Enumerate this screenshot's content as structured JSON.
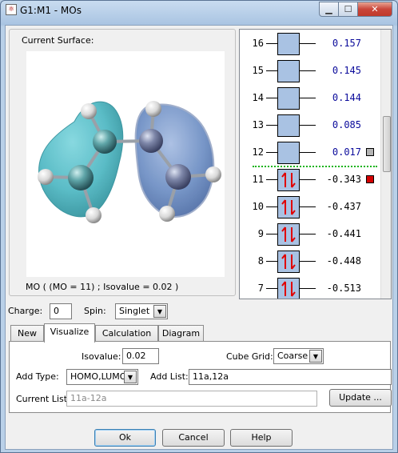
{
  "window": {
    "title": "G1:M1 - MOs",
    "icon": "gaussview-icon",
    "controls": {
      "minimize": "▁",
      "maximize": "☐",
      "close": "✕"
    }
  },
  "surface": {
    "label": "Current Surface:",
    "caption": "MO ( (MO = 11) ; Isovalue = 0.02 )"
  },
  "levels": [
    {
      "num": "16",
      "energy": "0.157",
      "occupied": false,
      "marker": ""
    },
    {
      "num": "15",
      "energy": "0.145",
      "occupied": false,
      "marker": ""
    },
    {
      "num": "14",
      "energy": "0.144",
      "occupied": false,
      "marker": ""
    },
    {
      "num": "13",
      "energy": "0.085",
      "occupied": false,
      "marker": ""
    },
    {
      "num": "12",
      "energy": "0.017",
      "occupied": false,
      "marker": "gray"
    },
    {
      "num": "11",
      "energy": "-0.343",
      "occupied": true,
      "marker": "red"
    },
    {
      "num": "10",
      "energy": "-0.437",
      "occupied": true,
      "marker": ""
    },
    {
      "num": "9",
      "energy": "-0.441",
      "occupied": true,
      "marker": ""
    },
    {
      "num": "8",
      "energy": "-0.448",
      "occupied": true,
      "marker": ""
    },
    {
      "num": "7",
      "energy": "-0.513",
      "occupied": true,
      "marker": ""
    }
  ],
  "colors": {
    "orbital_box": "#a9c2e3",
    "spin_arrow": "#e00000",
    "virtual_energy": "#0b0b9b",
    "homo_lumo_separator": "#19b319",
    "marker_gray": "#b4b4b4",
    "marker_red": "#d40000",
    "lobe_cyan": "#4fb8c3",
    "lobe_blue": "#6e8fc4"
  },
  "charge": {
    "label": "Charge:",
    "value": "0"
  },
  "spin": {
    "label": "Spin:",
    "value": "Singlet"
  },
  "tabs": [
    "New",
    "Visualize",
    "Calculation",
    "Diagram"
  ],
  "active_tab": "Visualize",
  "visualize": {
    "isovalue_label": "Isovalue:",
    "isovalue": "0.02",
    "cube_grid_label": "Cube Grid:",
    "cube_grid": "Coarse",
    "add_type_label": "Add Type:",
    "add_type": "HOMO,LUMO",
    "add_list_label": "Add List:",
    "add_list": "11a,12a",
    "current_list_label": "Current List:",
    "current_list": "11a-12a",
    "update_label": "Update ..."
  },
  "buttons": {
    "ok": "Ok",
    "cancel": "Cancel",
    "help": "Help"
  }
}
